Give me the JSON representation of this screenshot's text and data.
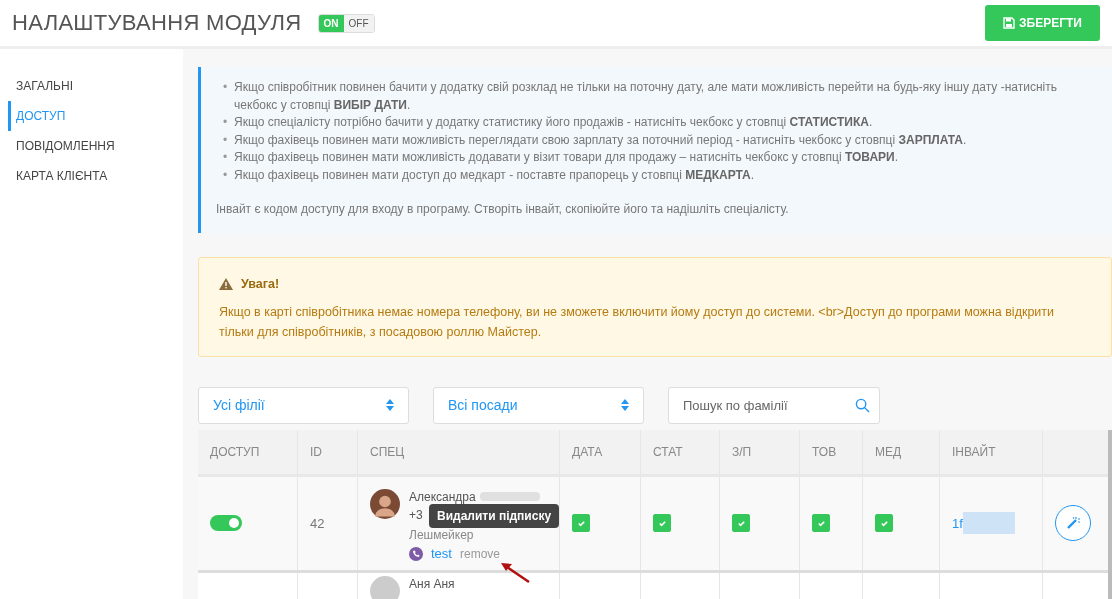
{
  "header": {
    "title": "НАЛАШТУВАННЯ МОДУЛЯ",
    "module_switch": [
      {
        "label": "ON",
        "selected": true
      },
      {
        "label": "OFF",
        "selected": false
      }
    ],
    "save_button": "ЗБЕРЕГТИ"
  },
  "sidebar": {
    "items": [
      {
        "label": "ЗАГАЛЬНІ",
        "selected": false
      },
      {
        "label": "ДОСТУП",
        "selected": true
      },
      {
        "label": "ПОВІДОМЛЕННЯ",
        "selected": false
      },
      {
        "label": "КАРТА КЛІЄНТА",
        "selected": false
      }
    ]
  },
  "info": {
    "marker": "•",
    "bullets": [
      "Якщо співробітник повинен бачити у додатку свій розклад не тільки на поточну дату, але мати можливість перейти на будь-яку іншу дату -натисніть чекбокс у стовпці **ВИБІР ДАТИ**.",
      "Якщо спеціалісту потрібно бачити у додатку статистику його продажів - натисніть чекбокс у стовпці **СТАТИСТИКА**.",
      "Якщо фахівець повинен мати можливість переглядати свою зарплату за поточний період - натисніть чекбокс у стовпці **ЗАРПЛАТА**.",
      "Якщо фахівець повинен мати можливість додавати у візит товари для продажу – натисніть чекбокс у стовпці **ТОВАРИ**.",
      "Якщо фахівець повинен мати доступ до медкарт - поставте прапорець у стовпці **МЕДКАРТА**."
    ],
    "note": "Інвайт є кодом доступу для входу в програму. Створіть інвайт, скопіюйте його та надішліть спеціалісту."
  },
  "warning": {
    "title": "Увага!",
    "text": "Якщо в карті співробітника немає номера телефону, ви не зможете включити йому доступ до системи. <br>Доступ до програми можна відкрити тільки для співробітників, з посадовою роллю Майстер."
  },
  "filters": {
    "branch": "Усі філії",
    "position": "Всі посади",
    "search": {
      "placeholder": "Пошук по фамілії"
    }
  },
  "table": {
    "columns": [
      "ДОСТУП",
      "ID",
      "СПЕЦ",
      "ДАТА",
      "СТАТ",
      "З/П",
      "ТОВ",
      "МЕД",
      "ІНВАЙТ"
    ],
    "rows": [
      {
        "access": true,
        "id": "42",
        "name": "Александра",
        "phone": "+3",
        "role": "Лешмейкер",
        "messenger": "test",
        "remove": "remove",
        "tooltip": "Видалити підписку",
        "date": true,
        "stat": true,
        "salary": true,
        "goods": true,
        "med": true,
        "invite": "1f"
      },
      {
        "name": "Аня Аня"
      }
    ]
  }
}
